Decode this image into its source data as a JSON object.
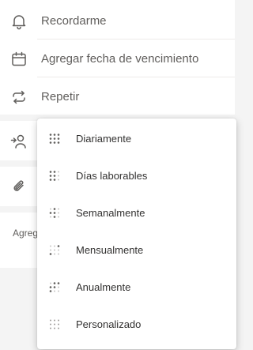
{
  "task_options": {
    "remind_label": "Recordarme",
    "due_date_label": "Agregar fecha de vencimiento",
    "repeat_label": "Repetir"
  },
  "note_placeholder": "Agregar nota",
  "repeat_menu": {
    "items": [
      {
        "label": "Diariamente",
        "icon": "daily-dots-icon"
      },
      {
        "label": "Días laborables",
        "icon": "weekdays-dots-icon"
      },
      {
        "label": "Semanalmente",
        "icon": "weekly-dots-icon"
      },
      {
        "label": "Mensualmente",
        "icon": "monthly-dots-icon"
      },
      {
        "label": "Anualmente",
        "icon": "yearly-dots-icon"
      },
      {
        "label": "Personalizado",
        "icon": "custom-dots-icon"
      }
    ]
  },
  "colors": {
    "background": "#f4f4f4",
    "card": "#ffffff",
    "text": "#323130",
    "secondary_text": "#605e5c"
  }
}
